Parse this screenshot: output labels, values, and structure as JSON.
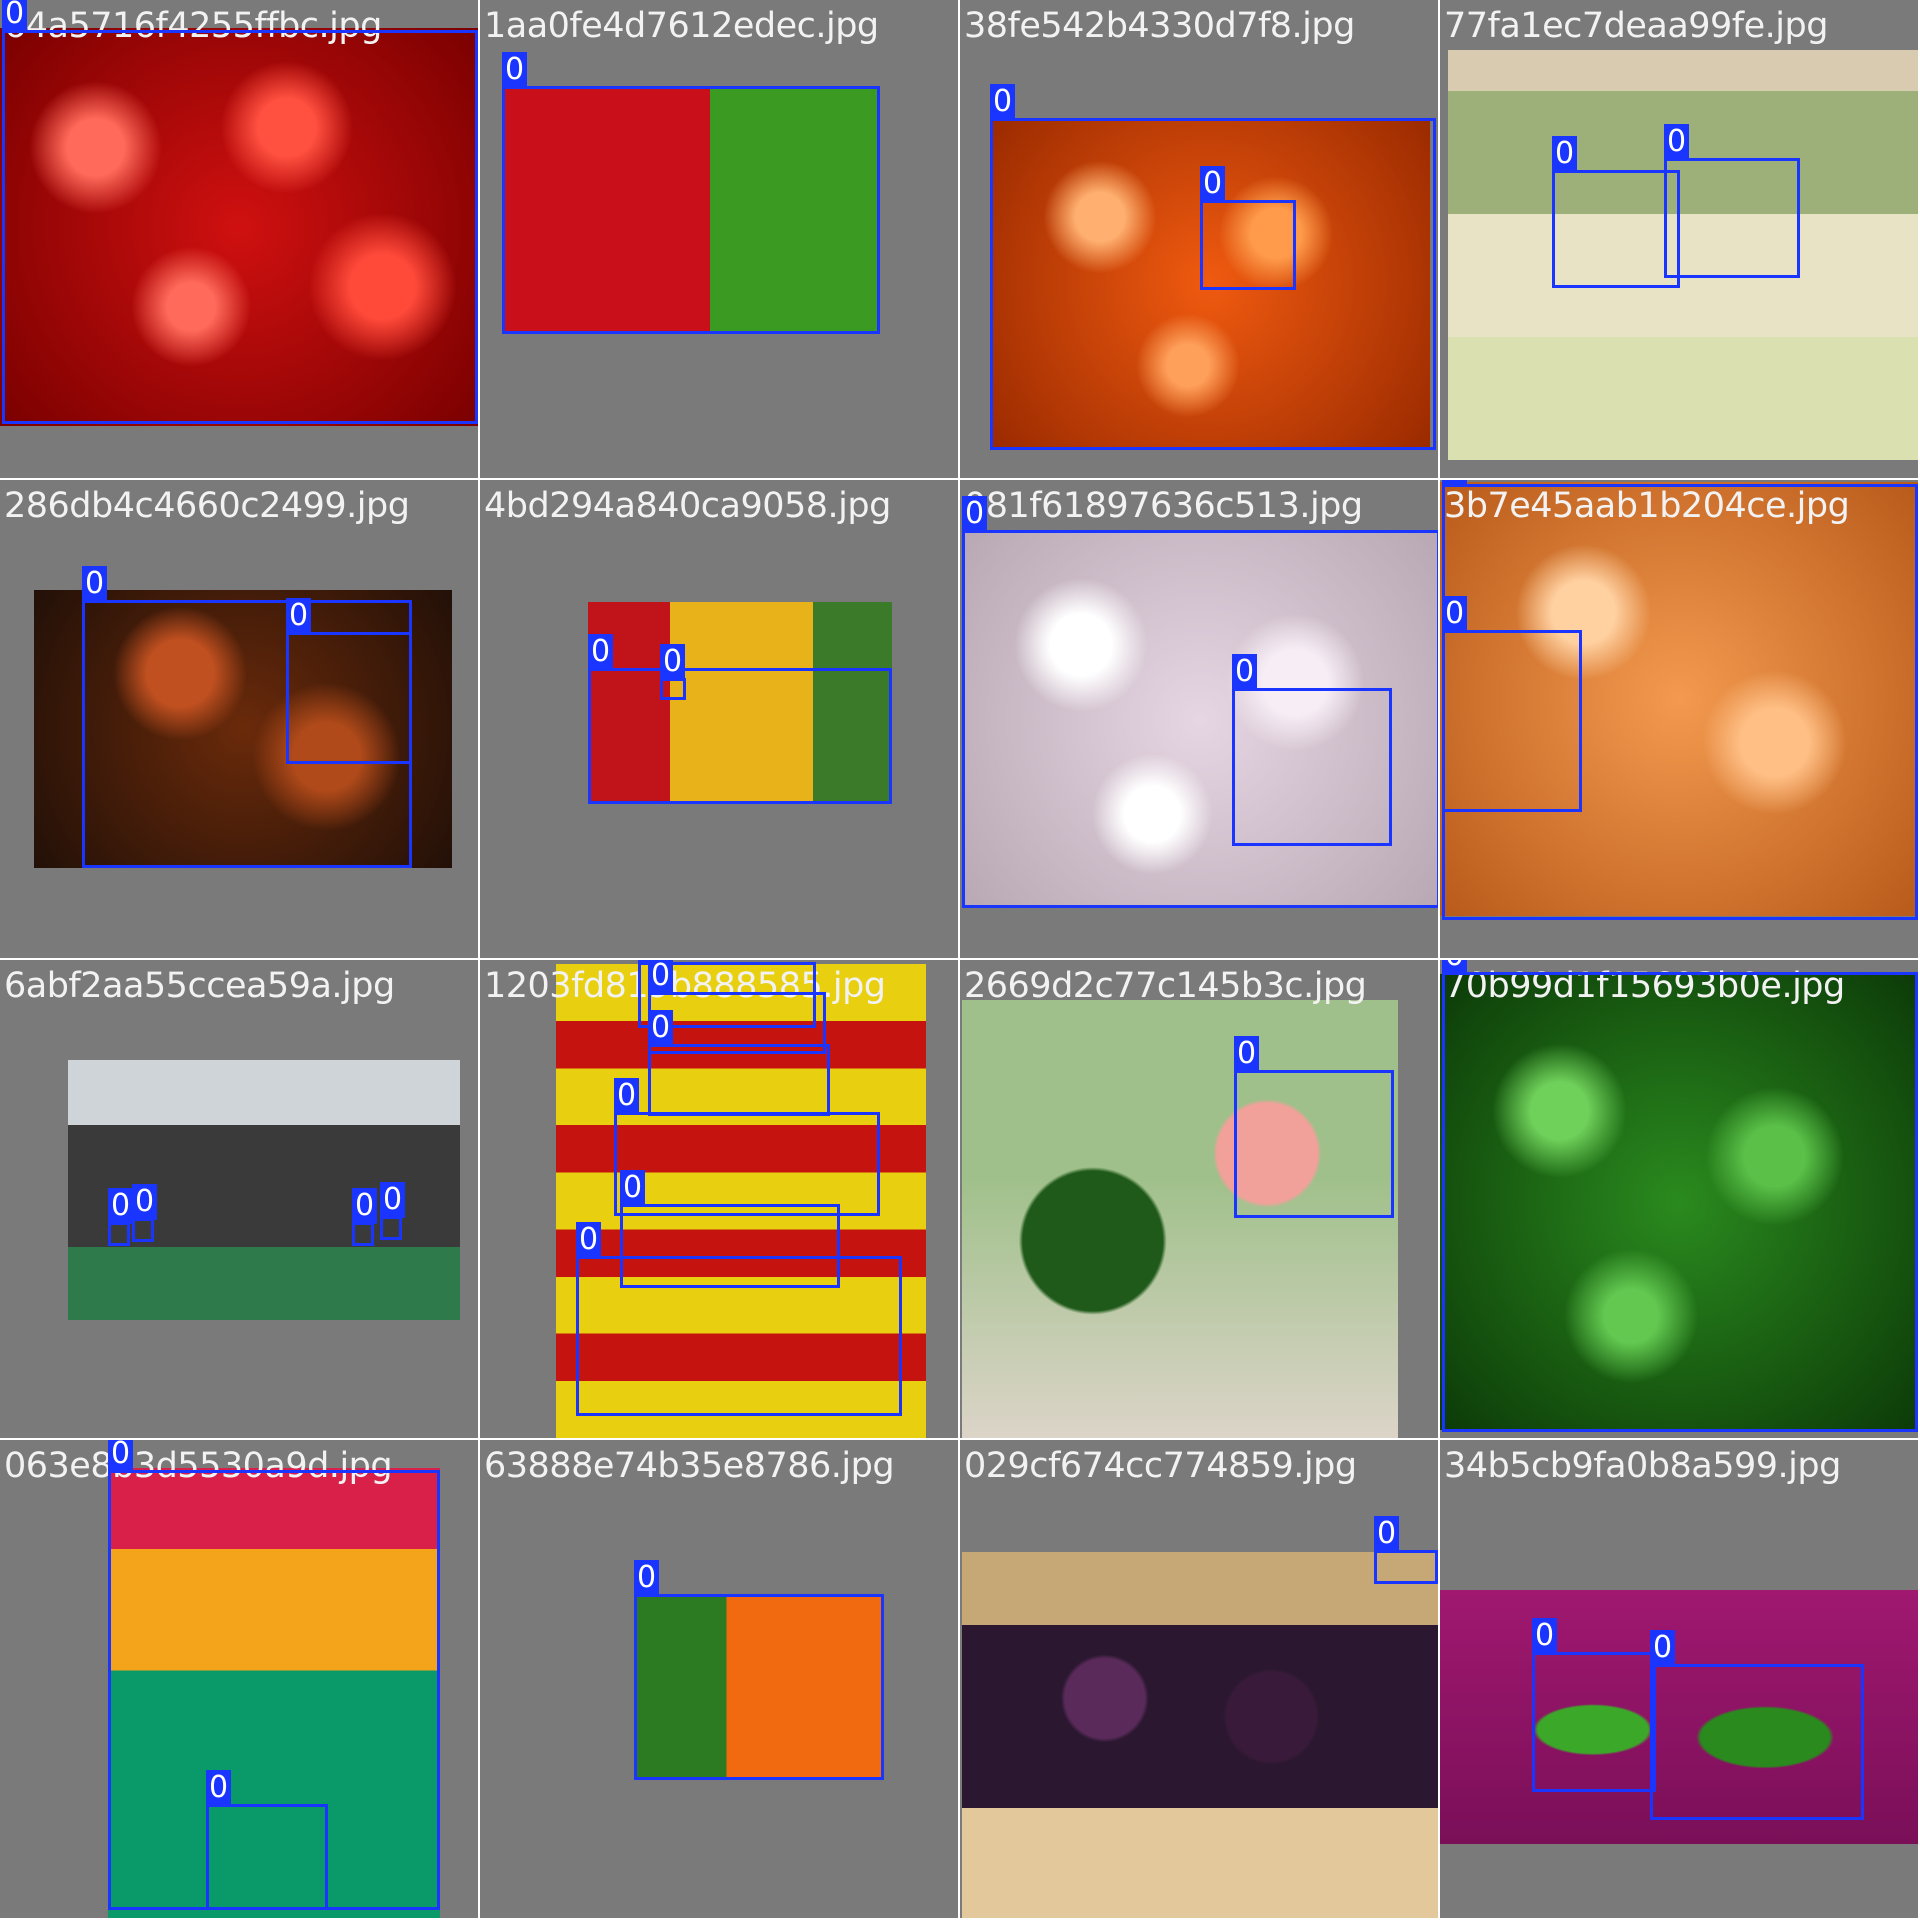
{
  "label_text": "0",
  "tiles": [
    {
      "filename": "64a5716f4255ffbc.jpg"
    },
    {
      "filename": "1aa0fe4d7612edec.jpg"
    },
    {
      "filename": "38fe542b4330d7f8.jpg"
    },
    {
      "filename": "77fa1ec7deaa99fe.jpg"
    },
    {
      "filename": "286db4c4660c2499.jpg"
    },
    {
      "filename": "4bd294a840ca9058.jpg"
    },
    {
      "filename": "081f61897636c513.jpg"
    },
    {
      "filename": "3b7e45aab1b204ce.jpg"
    },
    {
      "filename": "6abf2aa55ccea59a.jpg"
    },
    {
      "filename": "1203fd819b888585.jpg"
    },
    {
      "filename": "2669d2c77c145b3c.jpg"
    },
    {
      "filename": "70b99d1f15693b0e.jpg"
    },
    {
      "filename": "063e8b3d5530a9d.jpg"
    },
    {
      "filename": "63888e74b35e8786.jpg"
    },
    {
      "filename": "029cf674cc774859.jpg"
    },
    {
      "filename": "34b5cb9fa0b8a599.jpg"
    }
  ],
  "colors": {
    "box": "#1a35ff",
    "tile_bg": "#7a7a7a",
    "label_text": "#ffffff"
  }
}
